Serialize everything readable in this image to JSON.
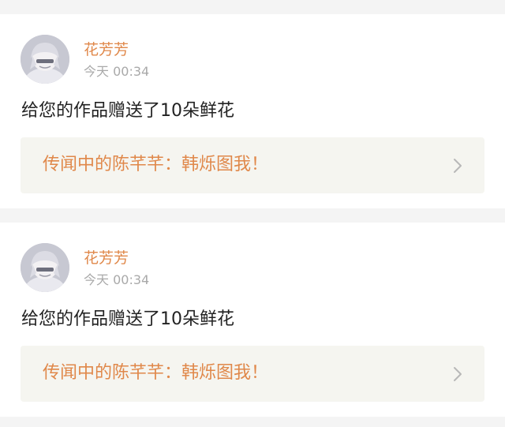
{
  "notifications": [
    {
      "username": "花芳芳",
      "timestamp": "今天 00:34",
      "message": "给您的作品赠送了10朵鲜花",
      "work_title": "传闻中的陈芊芊：韩烁图我！",
      "avatar_icon": "anime-avatar",
      "chevron_icon": "chevron-right-icon"
    },
    {
      "username": "花芳芳",
      "timestamp": "今天 00:34",
      "message": "给您的作品赠送了10朵鲜花",
      "work_title": "传闻中的陈芊芊：韩烁图我！",
      "avatar_icon": "anime-avatar",
      "chevron_icon": "chevron-right-icon"
    }
  ],
  "colors": {
    "accent": "#e0884a",
    "timestamp": "#a9a9a9",
    "text": "#222222",
    "card_background": "#ffffff",
    "link_background": "#f5f5f0",
    "page_background": "#f4f4f4"
  }
}
